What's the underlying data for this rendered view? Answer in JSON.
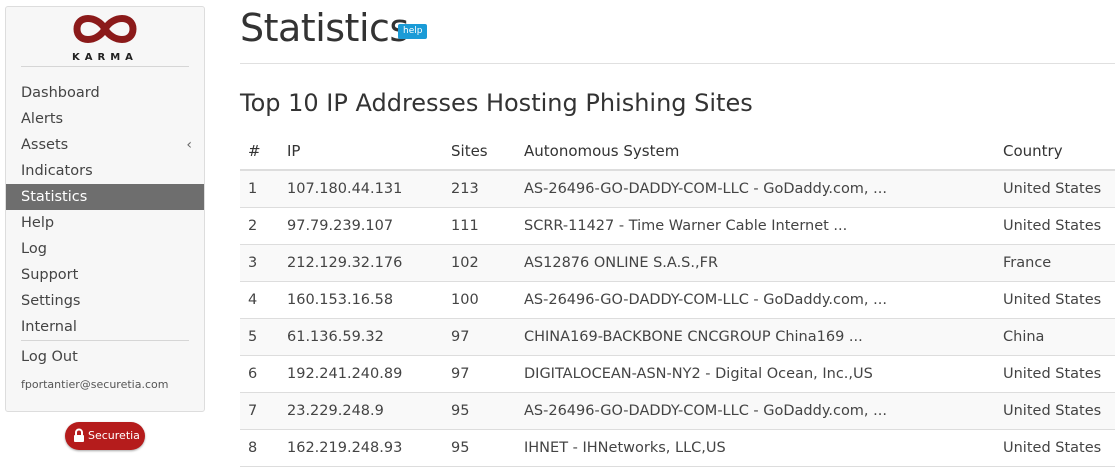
{
  "brand": {
    "logo_text": "KARMA",
    "logo_color": "#8b1a1a"
  },
  "sidebar": {
    "items": [
      {
        "label": "Dashboard"
      },
      {
        "label": "Alerts"
      },
      {
        "label": "Assets",
        "icon": "chevron-left-icon"
      },
      {
        "label": "Indicators"
      },
      {
        "label": "Statistics",
        "active": true
      },
      {
        "label": "Help"
      },
      {
        "label": "Log"
      },
      {
        "label": "Support"
      },
      {
        "label": "Settings"
      },
      {
        "label": "Internal"
      }
    ],
    "logout_label": "Log Out",
    "user_email": "fportantier@securetia.com"
  },
  "footer_badge": {
    "label": "Securetia",
    "icon": "lock-icon",
    "color": "#b51c1c"
  },
  "page": {
    "title": "Statistics",
    "help_label": "help",
    "help_color": "#1a9bd7"
  },
  "section": {
    "title": "Top 10 IP Addresses Hosting Phishing Sites"
  },
  "table": {
    "headers": [
      "#",
      "IP",
      "Sites",
      "Autonomous System",
      "Country"
    ],
    "rows": [
      [
        "1",
        "107.180.44.131",
        "213",
        "AS-26496-GO-DADDY-COM-LLC - GoDaddy.com, ...",
        "United States"
      ],
      [
        "2",
        "97.79.239.107",
        "111",
        "SCRR-11427 - Time Warner Cable Internet ...",
        "United States"
      ],
      [
        "3",
        "212.129.32.176",
        "102",
        "AS12876 ONLINE S.A.S.,FR",
        "France"
      ],
      [
        "4",
        "160.153.16.58",
        "100",
        "AS-26496-GO-DADDY-COM-LLC - GoDaddy.com, ...",
        "United States"
      ],
      [
        "5",
        "61.136.59.32",
        "97",
        "CHINA169-BACKBONE CNCGROUP China169 ...",
        "China"
      ],
      [
        "6",
        "192.241.240.89",
        "97",
        "DIGITALOCEAN-ASN-NY2 - Digital Ocean, Inc.,US",
        "United States"
      ],
      [
        "7",
        "23.229.248.9",
        "95",
        "AS-26496-GO-DADDY-COM-LLC - GoDaddy.com, ...",
        "United States"
      ],
      [
        "8",
        "162.219.248.93",
        "95",
        "IHNET - IHNetworks, LLC,US",
        "United States"
      ]
    ]
  }
}
